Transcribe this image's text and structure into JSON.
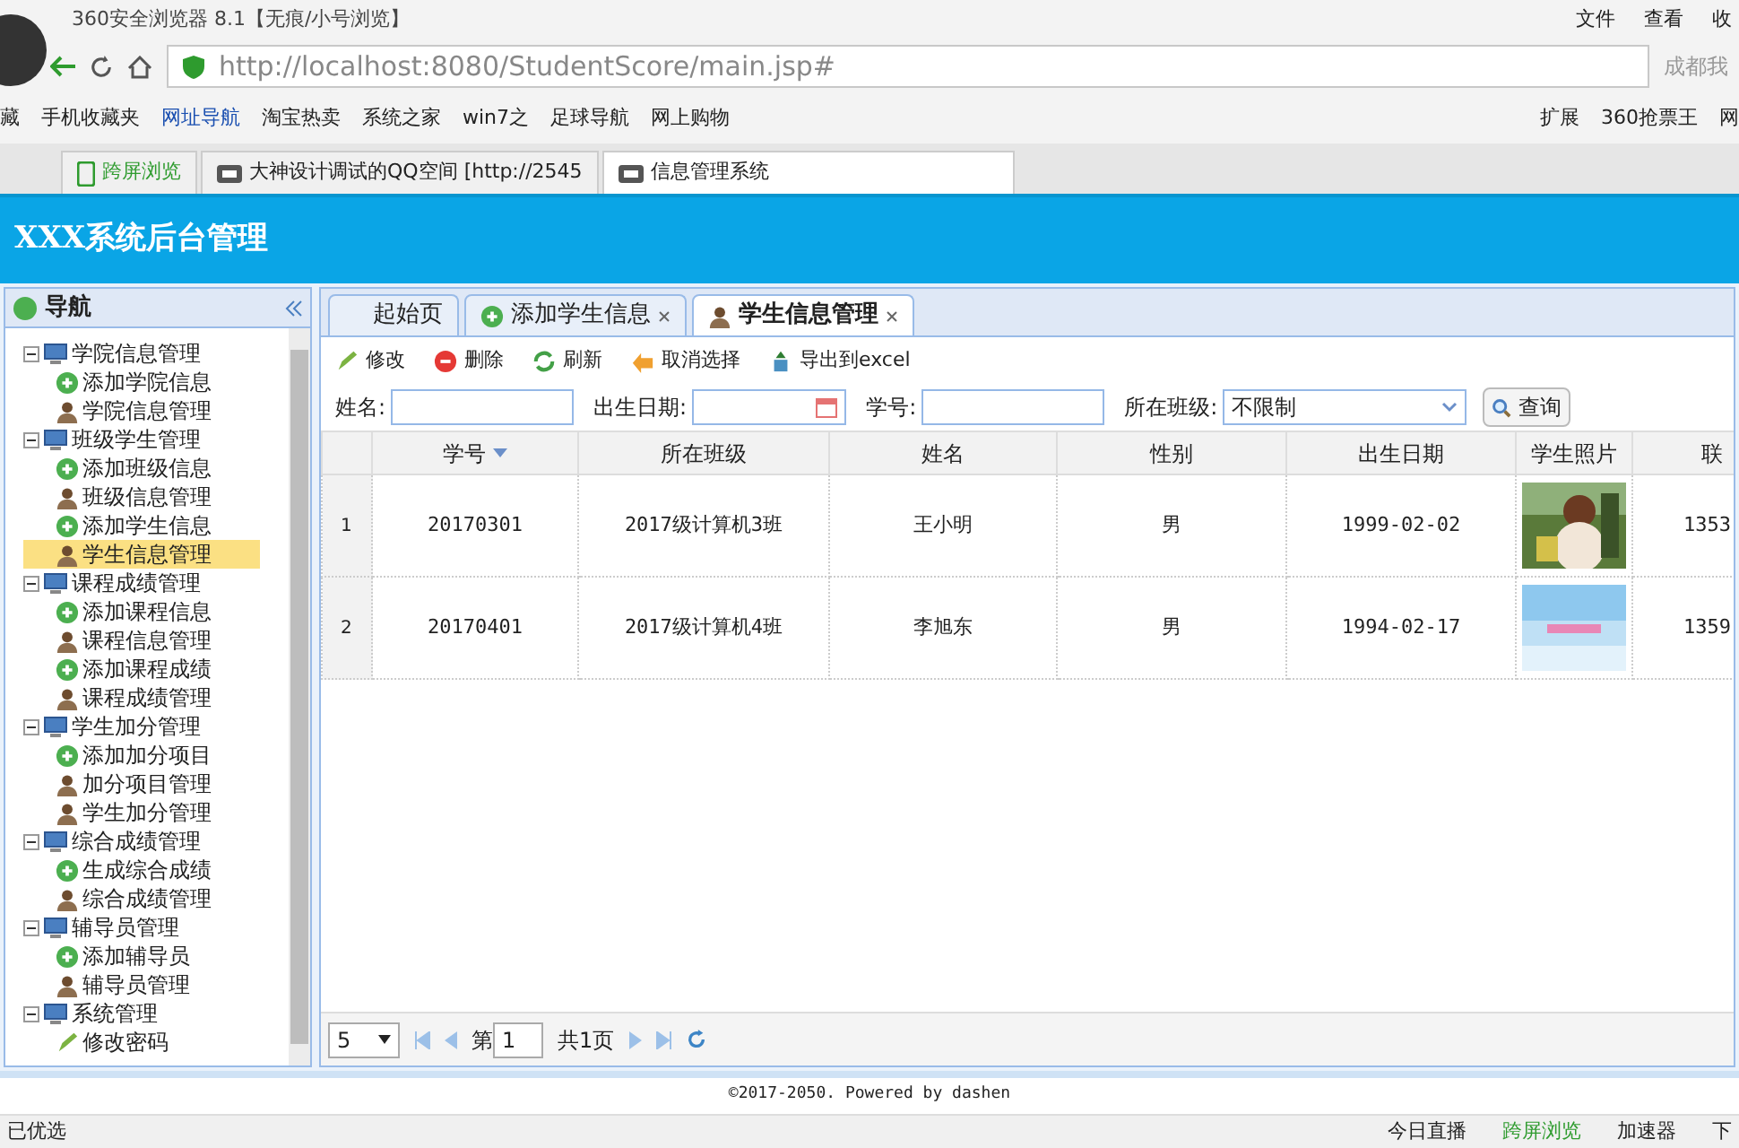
{
  "browser": {
    "title": "360安全浏览器 8.1【无痕/小号浏览】",
    "menu": [
      "文件",
      "查看",
      "收"
    ],
    "address": "http://localhost:8080/StudentScore/main.jsp#",
    "search_hint": "成都我",
    "bookmarks": [
      "藏",
      "手机收藏夹",
      "网址导航",
      "淘宝热卖",
      "系统之家",
      "win7之",
      "足球导航",
      "网上购物"
    ],
    "bookmarks_right": [
      "扩展",
      "360抢票王",
      "网"
    ],
    "tabs": [
      {
        "label": "跨屏浏览",
        "selected": false,
        "kind": "phone"
      },
      {
        "label": "大神设计调试的QQ空间 [http://2545",
        "selected": false,
        "kind": "page"
      },
      {
        "label": "信息管理系统",
        "selected": true,
        "kind": "page"
      }
    ]
  },
  "header": {
    "title": "XXX系统后台管理"
  },
  "nav": {
    "title": "导航",
    "groups": [
      {
        "label": "学院信息管理",
        "expanded": true,
        "children": [
          {
            "label": "添加学院信息",
            "kind": "add",
            "selected": false
          },
          {
            "label": "学院信息管理",
            "kind": "person",
            "selected": false
          }
        ]
      },
      {
        "label": "班级学生管理",
        "expanded": true,
        "children": [
          {
            "label": "添加班级信息",
            "kind": "add",
            "selected": false
          },
          {
            "label": "班级信息管理",
            "kind": "person",
            "selected": false
          },
          {
            "label": "添加学生信息",
            "kind": "add",
            "selected": false
          },
          {
            "label": "学生信息管理",
            "kind": "person",
            "selected": true
          }
        ]
      },
      {
        "label": "课程成绩管理",
        "expanded": true,
        "children": [
          {
            "label": "添加课程信息",
            "kind": "add",
            "selected": false
          },
          {
            "label": "课程信息管理",
            "kind": "person",
            "selected": false
          },
          {
            "label": "添加课程成绩",
            "kind": "add",
            "selected": false
          },
          {
            "label": "课程成绩管理",
            "kind": "person",
            "selected": false
          }
        ]
      },
      {
        "label": "学生加分管理",
        "expanded": true,
        "children": [
          {
            "label": "添加加分项目",
            "kind": "add",
            "selected": false
          },
          {
            "label": "加分项目管理",
            "kind": "person",
            "selected": false
          },
          {
            "label": "学生加分管理",
            "kind": "person",
            "selected": false
          }
        ]
      },
      {
        "label": "综合成绩管理",
        "expanded": true,
        "children": [
          {
            "label": "生成综合成绩",
            "kind": "add",
            "selected": false
          },
          {
            "label": "综合成绩管理",
            "kind": "person",
            "selected": false
          }
        ]
      },
      {
        "label": "辅导员管理",
        "expanded": true,
        "children": [
          {
            "label": "添加辅导员",
            "kind": "add",
            "selected": false
          },
          {
            "label": "辅导员管理",
            "kind": "person",
            "selected": false
          }
        ]
      },
      {
        "label": "系统管理",
        "expanded": true,
        "children": [
          {
            "label": "修改密码",
            "kind": "edit",
            "selected": false
          }
        ]
      }
    ]
  },
  "content_tabs": [
    {
      "label": "起始页",
      "selected": false,
      "closable": false,
      "kind": "plain"
    },
    {
      "label": "添加学生信息",
      "selected": false,
      "closable": true,
      "kind": "add"
    },
    {
      "label": "学生信息管理",
      "selected": true,
      "closable": true,
      "kind": "person"
    }
  ],
  "toolbar": [
    {
      "label": "修改",
      "kind": "edit"
    },
    {
      "label": "删除",
      "kind": "delete"
    },
    {
      "label": "刷新",
      "kind": "refresh"
    },
    {
      "label": "取消选择",
      "kind": "undo"
    },
    {
      "label": "导出到excel",
      "kind": "export"
    }
  ],
  "filters": [
    {
      "label": "姓名:",
      "kind": "text"
    },
    {
      "label": "出生日期:",
      "kind": "date"
    },
    {
      "label": "学号:",
      "kind": "text"
    },
    {
      "label": "所在班级:",
      "kind": "select",
      "value": "不限制"
    }
  ],
  "query_button": "查询",
  "table": {
    "columns": [
      {
        "label": "学号",
        "sorted": true
      },
      {
        "label": "所在班级",
        "sorted": false
      },
      {
        "label": "姓名",
        "sorted": false
      },
      {
        "label": "性别",
        "sorted": false
      },
      {
        "label": "出生日期",
        "sorted": false
      },
      {
        "label": "学生照片",
        "sorted": false
      },
      {
        "label": "联",
        "sorted": false
      }
    ],
    "rows": [
      {
        "index": "1",
        "cells": [
          "20170301",
          "2017级计算机3班",
          "王小明",
          "男",
          "1999-02-02",
          {
            "kind": "picture"
          },
          "1353"
        ]
      },
      {
        "index": "2",
        "cells": [
          "20170401",
          "2017级计算机4班",
          "李旭东",
          "男",
          "1994-02-17",
          {
            "kind": "picture"
          },
          "1359"
        ]
      }
    ]
  },
  "pager": {
    "page_size": "5",
    "page_label": "第",
    "page": "1",
    "total": "共1页"
  },
  "footer": "©2017-2050. Powered by dashen",
  "status": {
    "left": "已优选",
    "right": [
      "今日直播",
      "跨屏浏览",
      "加速器",
      "下"
    ]
  }
}
